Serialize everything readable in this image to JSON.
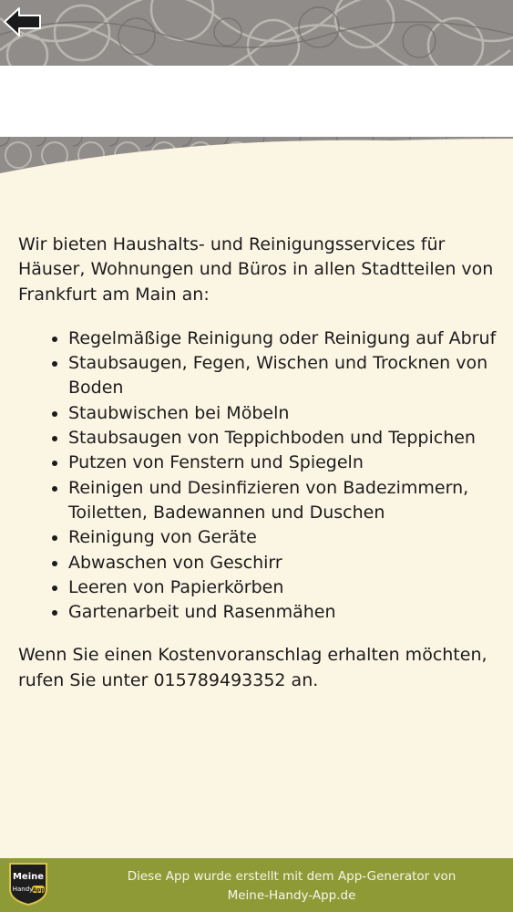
{
  "header": {
    "back_icon": "back-arrow-icon"
  },
  "content": {
    "intro": "Wir bieten Haushalts- und Reinigungsservices für Häuser, Wohnungen und Büros in allen Stadtteilen von Frankfurt am Main an:",
    "services": [
      "Regelmäßige Reinigung oder Reinigung auf Abruf",
      "Staubsaugen, Fegen, Wischen und Trocknen von Boden",
      "Staubwischen bei Möbeln",
      "Staubsaugen von Teppichboden und Teppichen",
      "Putzen von Fenstern und Spiegeln",
      "Reinigen und Desinfizieren von Badezimmern, Toiletten, Badewannen und Duschen",
      "Reinigung von Geräte",
      "Abwaschen von Geschirr",
      "Leeren von Papierkörben",
      "Gartenarbeit und Rasenmähen"
    ],
    "outro": "Wenn Sie einen Kostenvoranschlag erhalten möchten, rufen Sie unter 015789493352 an."
  },
  "footer": {
    "logo_line1": "Meine",
    "logo_line2": "Handy",
    "logo_badge": "App",
    "text_line1": "Diese App wurde erstellt mit dem App-Generator von",
    "text_line2": "Meine-Handy-App.de"
  },
  "colors": {
    "background": "#fbf5e4",
    "header": "#8f8c89",
    "footer": "#8e9a35",
    "text": "#1c1c1c"
  }
}
